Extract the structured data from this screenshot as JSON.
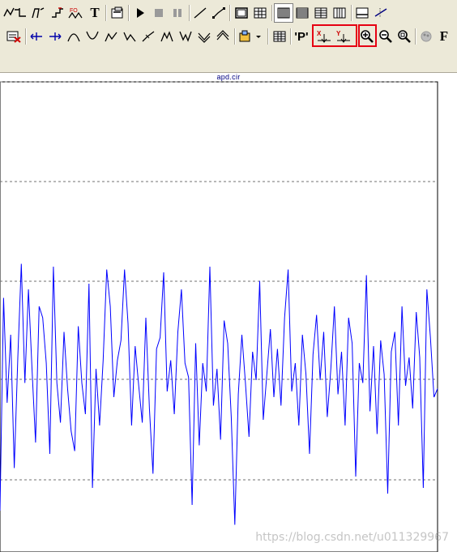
{
  "toolbar_row1": {
    "buttons": [
      {
        "name": "probe-icon"
      },
      {
        "name": "wire-icon"
      },
      {
        "name": "schematic-icon"
      },
      {
        "name": "step-icon"
      },
      {
        "name": "fourier-icon"
      },
      {
        "name": "text-label"
      },
      {
        "name": "edit-props-icon"
      },
      {
        "name": "run-icon"
      },
      {
        "name": "stop-icon"
      },
      {
        "name": "pause-icon"
      },
      {
        "name": "line-icon"
      },
      {
        "name": "polyline-icon"
      },
      {
        "name": "frame-icon"
      },
      {
        "name": "grid-icon"
      },
      {
        "name": "h-bars-icon"
      },
      {
        "name": "h-lines-icon"
      },
      {
        "name": "h-grid-icon"
      },
      {
        "name": "v-grid-icon"
      },
      {
        "name": "axis-icon"
      },
      {
        "name": "cursor-icon"
      }
    ],
    "text_button_label": "T"
  },
  "toolbar_row2": {
    "p_button_label": "'P'",
    "f_button_label": "F",
    "tools": [
      "delete-curve-icon",
      "cursor-left-icon",
      "cursor-right-icon",
      "peak-icon",
      "valley-icon",
      "high-icon",
      "low-icon",
      "inflect-icon",
      "top-icon",
      "bottom-icon",
      "global-high-icon",
      "global-low-icon",
      "tag-icon",
      "table-icon",
      "p-label",
      "x-tag-icon",
      "y-tag-icon",
      "zoom-in-icon",
      "zoom-out-icon",
      "zoom-fit-icon",
      "color-icon",
      "font-button"
    ]
  },
  "plot": {
    "title": "apd.cir",
    "line_color": "#0000ff",
    "grid_color": "#707070",
    "gridlines": 5,
    "y_values": [
      0.1,
      0.85,
      0.48,
      0.72,
      0.25,
      0.64,
      0.97,
      0.55,
      0.88,
      0.6,
      0.34,
      0.82,
      0.78,
      0.62,
      0.3,
      0.96,
      0.55,
      0.41,
      0.73,
      0.53,
      0.38,
      0.31,
      0.75,
      0.55,
      0.44,
      0.9,
      0.18,
      0.6,
      0.4,
      0.63,
      0.95,
      0.82,
      0.5,
      0.63,
      0.7,
      0.95,
      0.76,
      0.4,
      0.68,
      0.54,
      0.41,
      0.78,
      0.46,
      0.23,
      0.67,
      0.71,
      0.94,
      0.52,
      0.63,
      0.44,
      0.73,
      0.88,
      0.62,
      0.57,
      0.12,
      0.69,
      0.33,
      0.62,
      0.52,
      0.96,
      0.47,
      0.6,
      0.35,
      0.77,
      0.69,
      0.43,
      0.05,
      0.51,
      0.72,
      0.55,
      0.36,
      0.66,
      0.56,
      0.91,
      0.42,
      0.58,
      0.74,
      0.5,
      0.67,
      0.47,
      0.78,
      0.95,
      0.52,
      0.62,
      0.4,
      0.72,
      0.58,
      0.3,
      0.65,
      0.79,
      0.56,
      0.73,
      0.43,
      0.6,
      0.82,
      0.51,
      0.66,
      0.4,
      0.78,
      0.69,
      0.22,
      0.62,
      0.55,
      0.93,
      0.45,
      0.68,
      0.37,
      0.7,
      0.58,
      0.16,
      0.66,
      0.73,
      0.4,
      0.82,
      0.54,
      0.64,
      0.46,
      0.8,
      0.64,
      0.18,
      0.88,
      0.71,
      0.5,
      0.53
    ],
    "watermark": "https://blog.csdn.net/u011329967"
  }
}
